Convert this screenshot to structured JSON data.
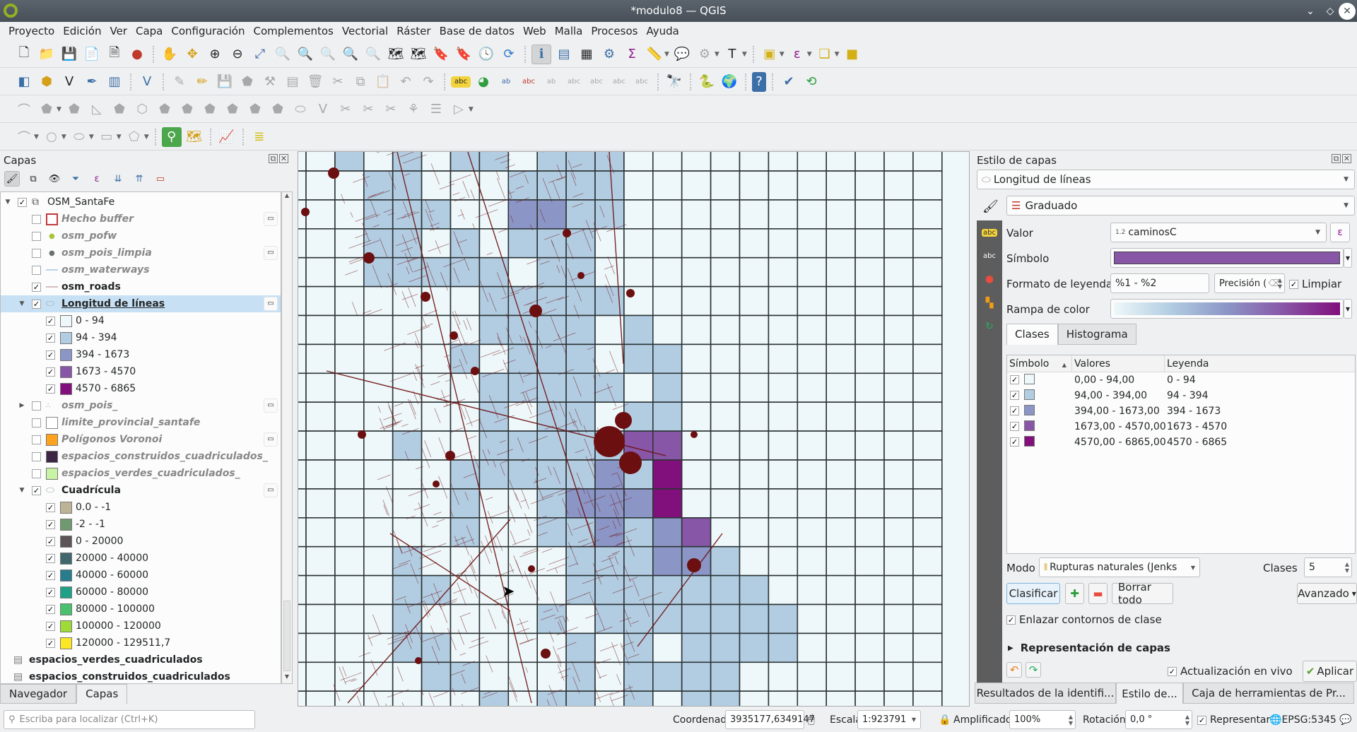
{
  "window": {
    "title": "*modulo8 — QGIS"
  },
  "menu": [
    "Proyecto",
    "Edición",
    "Ver",
    "Capa",
    "Configuración",
    "Complementos",
    "Vectorial",
    "Ráster",
    "Base de datos",
    "Web",
    "Malla",
    "Procesos",
    "Ayuda"
  ],
  "toolbars": {
    "row1": [
      "new-project",
      "open-project",
      "save-project",
      "new-print-layout",
      "layout-manager",
      "style-manager",
      "|",
      "pan",
      "pan-to-selection",
      "zoom-in",
      "zoom-out",
      "zoom-full",
      "zoom-to-selection",
      "zoom-to-layer",
      "zoom-native",
      "zoom-last",
      "zoom-next",
      "new-map-view",
      "new-3d-map-view",
      "new-bookmark",
      "show-bookmarks",
      "temporal-controller",
      "refresh",
      "|",
      "identify",
      "open-attribute-table",
      "field-calculator",
      "processing-toolbox",
      "statistical-summary",
      "measure",
      "map-tips",
      "annotation",
      "text-annotation",
      "|",
      "select-features",
      "select-by-expression",
      "deselect",
      "select-by-location"
    ],
    "row2": [
      "data-source-manager",
      "new-geopackage",
      "new-shapefile",
      "new-spatialite",
      "new-virtual-layer",
      "new-temporary-layer",
      "|",
      "current-edits",
      "toggle-editing",
      "save-edits",
      "add-polygon",
      "vertex-tool",
      "modify-attributes",
      "delete-selected",
      "cut",
      "copy",
      "paste",
      "undo",
      "redo",
      "|",
      "label-tool",
      "diagram-tool",
      "pin-labels",
      "show-hide-labels",
      "move-label",
      "rotate-label",
      "change-label",
      "label-settings",
      "|",
      "geocoding",
      "|",
      "python-console",
      "globe",
      "|",
      "help",
      "|",
      "topology-checker",
      "refresh-table"
    ],
    "row3": [
      "add-circular-string",
      "reshape",
      "offset-curve",
      "measure-angle",
      "simplify",
      "add-ring",
      "add-part",
      "fill-ring",
      "delete-ring",
      "delete-part",
      "reshape-features",
      "merge",
      "split-features",
      "split-parts",
      "merge-attributes",
      "rotate-point",
      "align"
    ],
    "row4": [
      "circular-string",
      "circle",
      "ellipse",
      "rectangle",
      "regular-polygon",
      "|",
      "search",
      "georeferencer",
      "|",
      "profile-tool",
      "|",
      "layer-order"
    ]
  },
  "layers_panel": {
    "title": "Capas",
    "items": [
      {
        "label": "OSM_SantaFe",
        "level": 0,
        "checked": true,
        "expanded": true,
        "icon": "group-icon",
        "style": "normal"
      },
      {
        "label": "Hecho buffer",
        "level": 1,
        "checked": false,
        "icon": "polygon-outline",
        "swatch": "#ffffff",
        "outline": "#c0393b",
        "style": "off",
        "embedded": true
      },
      {
        "label": "osm_pofw",
        "level": 1,
        "checked": false,
        "icon": "point",
        "swatch": "#a9c43a",
        "style": "off"
      },
      {
        "label": "osm_pois_limpia",
        "level": 1,
        "checked": false,
        "icon": "point",
        "swatch": "#6b7173",
        "style": "off",
        "embedded": true
      },
      {
        "label": "osm_waterways",
        "level": 1,
        "checked": false,
        "icon": "line",
        "swatch": "#b6d2ee",
        "style": "off"
      },
      {
        "label": "osm_roads",
        "level": 1,
        "checked": true,
        "icon": "line",
        "swatch": "#d2bebe",
        "style": "bold"
      },
      {
        "label": "Longitud de líneas",
        "level": 1,
        "checked": true,
        "expanded": true,
        "icon": "polygon-layer",
        "style": "bold-underline",
        "selected": true,
        "embedded": true
      },
      {
        "label": "0 - 94",
        "level": 2,
        "checked": true,
        "swatch": "#eef8fa"
      },
      {
        "label": "94 - 394",
        "level": 2,
        "checked": true,
        "swatch": "#b2cde2"
      },
      {
        "label": "394 - 1673",
        "level": 2,
        "checked": true,
        "swatch": "#8c96c6"
      },
      {
        "label": "1673 - 4570",
        "level": 2,
        "checked": true,
        "swatch": "#8856a7"
      },
      {
        "label": "4570 - 6865",
        "level": 2,
        "checked": true,
        "swatch": "#810f7c"
      },
      {
        "label": "osm_pois_",
        "level": 1,
        "checked": false,
        "expanded": false,
        "icon": "points",
        "style": "off",
        "embedded": true
      },
      {
        "label": "limite_provincial_santafe",
        "level": 1,
        "checked": false,
        "swatch": "#ffffff",
        "outline": "#888888",
        "style": "off"
      },
      {
        "label": "Polígonos Voronoi",
        "level": 1,
        "checked": false,
        "swatch": "#fea31e",
        "style": "off",
        "embedded": true
      },
      {
        "label": "espacios_construidos_cuadriculados_",
        "level": 1,
        "checked": false,
        "swatch": "#3d2546",
        "style": "off"
      },
      {
        "label": "espacios_verdes_cuadriculados_",
        "level": 1,
        "checked": false,
        "swatch": "#c8f2a4",
        "style": "off"
      },
      {
        "label": "Cuadrícula",
        "level": 1,
        "checked": true,
        "expanded": true,
        "icon": "polygon-layer",
        "style": "bold",
        "embedded": true
      },
      {
        "label": "0.0 - -1",
        "level": 2,
        "checked": true,
        "swatch": "#bdb497"
      },
      {
        "label": "-2 - -1",
        "level": 2,
        "checked": true,
        "swatch": "#6f9a70"
      },
      {
        "label": "0 - 20000",
        "level": 2,
        "checked": true,
        "swatch": "#5d5458"
      },
      {
        "label": "20000 - 40000",
        "level": 2,
        "checked": true,
        "swatch": "#41676e"
      },
      {
        "label": "40000 - 60000",
        "level": 2,
        "checked": true,
        "swatch": "#287c8e"
      },
      {
        "label": "60000 - 80000",
        "level": 2,
        "checked": true,
        "swatch": "#1fa187"
      },
      {
        "label": "80000 - 100000",
        "level": 2,
        "checked": true,
        "swatch": "#4ac16d"
      },
      {
        "label": "100000 - 120000",
        "level": 2,
        "checked": true,
        "swatch": "#a0da39"
      },
      {
        "label": "120000 - 129511,7",
        "level": 2,
        "checked": true,
        "swatch": "#fde725"
      },
      {
        "label": "espacios_verdes_cuadriculados",
        "level": 0,
        "icon": "table",
        "style": "bold",
        "nocheck": true
      },
      {
        "label": "espacios_construidos_cuadriculados",
        "level": 0,
        "icon": "table",
        "style": "bold",
        "nocheck": true
      }
    ],
    "tabs": [
      "Navegador",
      "Capas"
    ],
    "active_tab": "Capas",
    "locator_placeholder": "Escriba para localizar (Ctrl+K)"
  },
  "map": {
    "class_colors": [
      "#eef8fa",
      "#b2cde2",
      "#8c96c6",
      "#8856a7",
      "#810f7c"
    ],
    "grid_line_color": "#2d3436",
    "road_color": "#6b0f10",
    "cells": [
      "00101011011100000000000",
      "00011000111100000000000",
      "00011100221100000000000",
      "00011010111000000000000",
      "00011111011000000000000",
      "00000001111100000000000",
      "00000001111010000000000",
      "00000010111011000000000",
      "00000001111101000000000",
      "00000001011011000000000",
      "00001001111133000000000",
      "00000011111214000000000",
      "00000010012224000000000",
      "00000010011212300000000",
      "00001000001112210000000",
      "00001100001111111000000",
      "00001000010111111100000",
      "00001100001010111100000",
      "00000110001011110000000",
      "00000001011010110000000"
    ]
  },
  "style_panel": {
    "title": "Estilo de capas",
    "layer": "Longitud de líneas",
    "renderer": "Graduado",
    "value_label": "Valor",
    "value_type": "1.2",
    "value": "caminosC",
    "symbol_label": "Símbolo",
    "symbol_color": "#8856a7",
    "legend_format_label": "Formato de leyenda",
    "legend_format": "%1 - %2",
    "precision_placeholder": "Precisión (",
    "trim_label": "Limpiar",
    "trim_checked": true,
    "ramp_label": "Rampa de color",
    "ramp_colors": [
      "#eef8fa",
      "#b2cde2",
      "#8c96c6",
      "#8856a7",
      "#810f7c"
    ],
    "tabs": [
      "Clases",
      "Histograma"
    ],
    "active_tab": "Clases",
    "columns": [
      "Símbolo",
      "Valores",
      "Leyenda"
    ],
    "classes": [
      {
        "checked": true,
        "color": "#eef8fa",
        "values": "0,00 - 94,00",
        "legend": "0 - 94"
      },
      {
        "checked": true,
        "color": "#b2cde2",
        "values": "94,00 - 394,00",
        "legend": "94 - 394"
      },
      {
        "checked": true,
        "color": "#8c96c6",
        "values": "394,00 - 1673,00",
        "legend": "394 - 1673"
      },
      {
        "checked": true,
        "color": "#8856a7",
        "values": "1673,00 - 4570,00",
        "legend": "1673 - 4570"
      },
      {
        "checked": true,
        "color": "#810f7c",
        "values": "4570,00 - 6865,00",
        "legend": "4570 - 6865"
      }
    ],
    "mode_label": "Modo",
    "mode": "Rupturas naturales (Jenks)",
    "classes_label": "Clases",
    "classes_count": "5",
    "classify": "Clasificar",
    "delete_all": "Borrar todo",
    "advanced": "Avanzado",
    "link_boundaries": "Enlazar contornos de clase",
    "link_checked": true,
    "layer_rendering": "Representación de capas",
    "live_update": "Actualización en vivo",
    "live_checked": true,
    "apply": "Aplicar"
  },
  "bottom_tabs": [
    "Resultados de la identifi...",
    "Estilo de...",
    "Caja de herramientas de Pr..."
  ],
  "bottom_active": "Estilo de...",
  "status": {
    "coord_label": "Coordenada",
    "coord": "3935177,6349147",
    "scale_label": "Escala",
    "scale": "1:923791",
    "magnifier_label": "Amplificador",
    "magnifier": "100%",
    "rotation_label": "Rotación",
    "rotation": "0,0 °",
    "render_label": "Representar",
    "render_checked": true,
    "crs": "EPSG:5345"
  }
}
